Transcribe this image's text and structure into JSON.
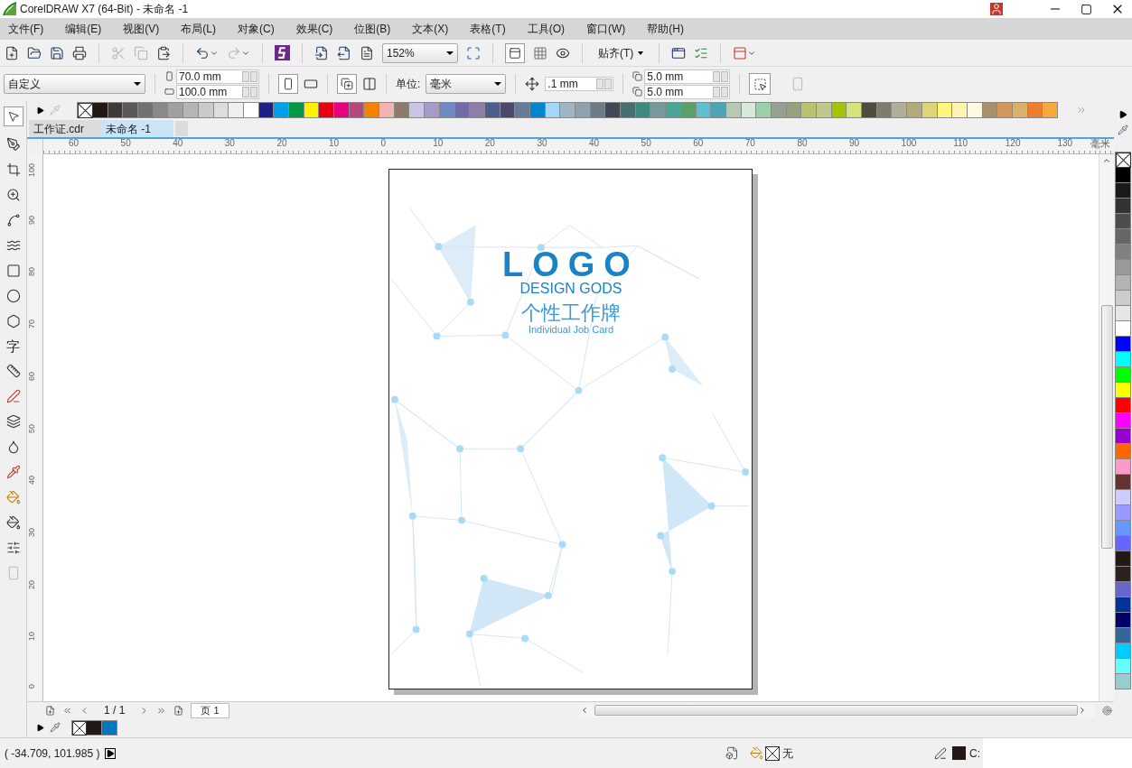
{
  "window": {
    "title": "CorelDRAW X7 (64-Bit) - 未命名 -1"
  },
  "menu": [
    "文件(F)",
    "编辑(E)",
    "视图(V)",
    "布局(L)",
    "对象(C)",
    "效果(C)",
    "位图(B)",
    "文本(X)",
    "表格(T)",
    "工具(O)",
    "窗口(W)",
    "帮助(H)"
  ],
  "toolbar": {
    "zoom": "152%",
    "snap": "贴齐(T)"
  },
  "property_bar": {
    "preset": "自定义",
    "width": "70.0 mm",
    "height": "100.0 mm",
    "unit_label": "单位:",
    "unit": "毫米",
    "nudge": ".1 mm",
    "dup_x": "5.0 mm",
    "dup_y": "5.0 mm"
  },
  "toolbox": {
    "text_tool": "字"
  },
  "palette": {
    "swatches": [
      {
        "color": "#231815"
      },
      {
        "color": "#3e3a39"
      },
      {
        "color": "#595757"
      },
      {
        "color": "#727171"
      },
      {
        "color": "#898989"
      },
      {
        "color": "#9fa0a0"
      },
      {
        "color": "#b5b5b6"
      },
      {
        "color": "#c9caca"
      },
      {
        "color": "#dcdddd"
      },
      {
        "color": "#efefef"
      },
      {
        "color": "#ffffff"
      },
      {
        "color": "#1d2088"
      },
      {
        "color": "#00a0e9"
      },
      {
        "color": "#009944"
      },
      {
        "color": "#fff100"
      },
      {
        "color": "#e60012"
      },
      {
        "color": "#e4007f"
      },
      {
        "color": "#b5487f"
      },
      {
        "color": "#f08300"
      },
      {
        "color": "#f4b3b3"
      },
      {
        "color": "#8f7a6e"
      },
      {
        "color": "#c9c5e2"
      },
      {
        "color": "#a69ac8"
      },
      {
        "color": "#6e89c4"
      },
      {
        "color": "#7469a9"
      },
      {
        "color": "#8c7ea6"
      },
      {
        "color": "#4e5f8e"
      },
      {
        "color": "#4b4a6b"
      },
      {
        "color": "#667a99"
      },
      {
        "color": "#0086d1"
      },
      {
        "color": "#9fd9f6"
      },
      {
        "color": "#a0b4c1"
      },
      {
        "color": "#8fa1ad"
      },
      {
        "color": "#6d7b86"
      },
      {
        "color": "#404a56"
      },
      {
        "color": "#476f72"
      },
      {
        "color": "#3d8a80"
      },
      {
        "color": "#78999b"
      },
      {
        "color": "#4aa598"
      },
      {
        "color": "#5aa06b"
      },
      {
        "color": "#5cbed1"
      },
      {
        "color": "#4aa6b5"
      },
      {
        "color": "#b7c8b4"
      },
      {
        "color": "#d6ead5"
      },
      {
        "color": "#9ad0a8"
      },
      {
        "color": "#959f94"
      },
      {
        "color": "#97a07b"
      },
      {
        "color": "#b9c26f"
      },
      {
        "color": "#c0c68f"
      },
      {
        "color": "#a5c400"
      },
      {
        "color": "#d8e27d"
      },
      {
        "color": "#4d4d3e"
      },
      {
        "color": "#807c6c"
      },
      {
        "color": "#b2ad98"
      },
      {
        "color": "#b4a97b"
      },
      {
        "color": "#dcd676"
      },
      {
        "color": "#fff57f"
      },
      {
        "color": "#fff5b1"
      },
      {
        "color": "#fffadf"
      },
      {
        "color": "#a88f6e"
      },
      {
        "color": "#d4955a"
      },
      {
        "color": "#d8b269"
      },
      {
        "color": "#ed7d31"
      },
      {
        "color": "#f6a83a"
      }
    ]
  },
  "tabs": [
    {
      "label": "工作证.cdr",
      "selected": false
    },
    {
      "label": "未命名 -1",
      "selected": true
    }
  ],
  "ruler": {
    "h_ticks": [
      "60",
      "50",
      "40",
      "30",
      "20",
      "10",
      "0",
      "10",
      "20",
      "30",
      "40",
      "50",
      "60",
      "70",
      "80",
      "90",
      "100",
      "110",
      "120",
      "130"
    ],
    "unit": "毫米",
    "v_ticks": [
      "100",
      "90",
      "80",
      "70",
      "60",
      "50",
      "40",
      "30",
      "20",
      "10",
      "0"
    ]
  },
  "page": {
    "logo": "LOGO",
    "brand": "DESIGN GODS",
    "title_cn": "个性工作牌",
    "title_en": "Individual Job Card"
  },
  "navigator": {
    "page_count": "1 / 1",
    "page_tab": "页 1"
  },
  "document_palette": {
    "swatches": [
      {
        "color": "#231815"
      },
      {
        "color": "#0077c0"
      }
    ]
  },
  "side_palette": {
    "swatches": [
      {
        "color": "#000000"
      },
      {
        "color": "#1a1a1a"
      },
      {
        "color": "#333333"
      },
      {
        "color": "#4d4d4d"
      },
      {
        "color": "#666666"
      },
      {
        "color": "#808080"
      },
      {
        "color": "#999999"
      },
      {
        "color": "#b3b3b3"
      },
      {
        "color": "#cccccc"
      },
      {
        "color": "#e6e6e6"
      },
      {
        "color": "#ffffff"
      },
      {
        "color": "#0000ff"
      },
      {
        "color": "#00ffff"
      },
      {
        "color": "#00ff00"
      },
      {
        "color": "#ffff00"
      },
      {
        "color": "#ff0000"
      },
      {
        "color": "#ff00ff"
      },
      {
        "color": "#9900cc"
      },
      {
        "color": "#ff6600"
      },
      {
        "color": "#ff99cc"
      },
      {
        "color": "#663333"
      },
      {
        "color": "#ccccff"
      },
      {
        "color": "#9999ff"
      },
      {
        "color": "#6699ff"
      },
      {
        "color": "#6666ff"
      },
      {
        "color": "#231815"
      },
      {
        "color": "#2b2320"
      },
      {
        "color": "#6666cc"
      },
      {
        "color": "#003399"
      },
      {
        "color": "#000066"
      },
      {
        "color": "#336699"
      },
      {
        "color": "#00ccff"
      },
      {
        "color": "#66ffff"
      },
      {
        "color": "#99cccc"
      }
    ]
  },
  "status_bar": {
    "coords": "( -34.709, 101.985 )",
    "fill": "无",
    "outline": "C:"
  }
}
